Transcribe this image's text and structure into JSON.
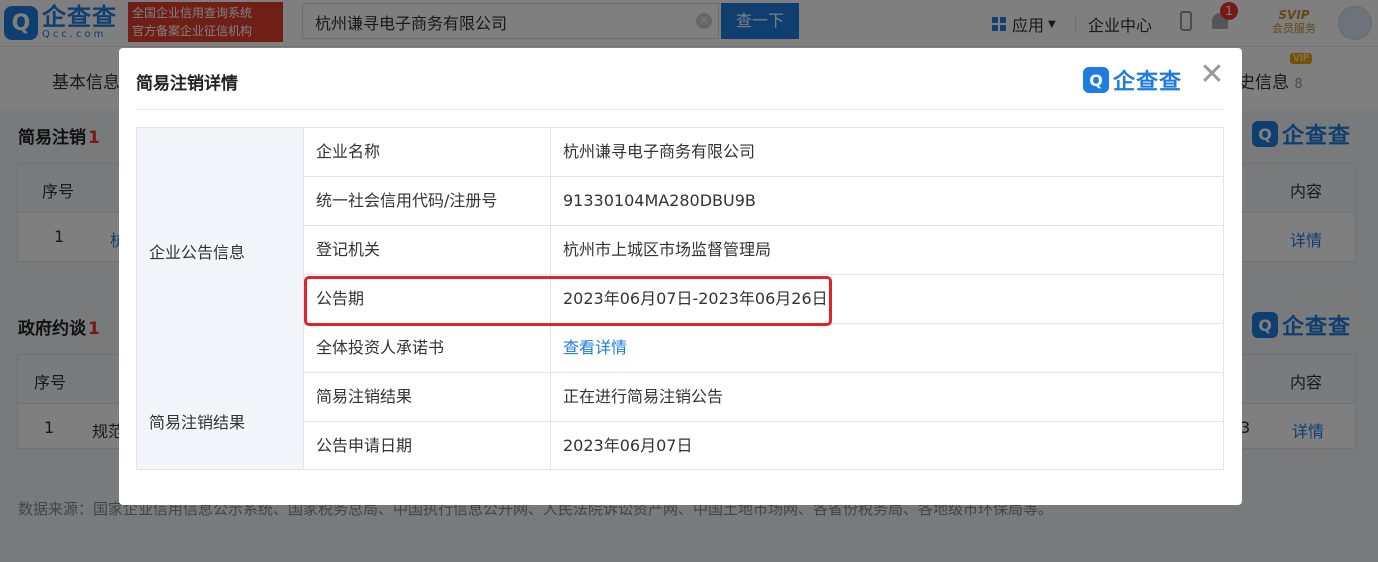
{
  "header": {
    "logo_cn": "企查查",
    "logo_en": "Qcc.com",
    "slogan_line1": "全国企业信用查询系统",
    "slogan_line2": "官方备案企业征信机构",
    "search_value": "杭州谦寻电子商务有限公司",
    "search_button": "查一下",
    "nav_app": "应用",
    "nav_center": "企业中心",
    "notification_count": "1",
    "svip_label": "SVIP",
    "svip_sub": "会员服务"
  },
  "subnav": {
    "basic_info": "基本信息",
    "history_info": "史信息",
    "history_count": "8",
    "vip_badge": "VIP"
  },
  "background": {
    "section1_title": "简易注销",
    "section1_count": "1",
    "section2_title": "政府约谈",
    "section2_count": "1",
    "col_index": "序号",
    "col_content": "内容",
    "row_index": "1",
    "row1_partial": "杭",
    "row2_partial": "规范",
    "row2_tail": "3",
    "detail_link": "详情",
    "source_text": "数据来源：国家企业信用信息公示系统、国家税务总局、中国执行信息公开网、人民法院诉讼资产网、中国土地市场网、各省份税务局、各地级市环保局等。",
    "logo_cn": "企查查"
  },
  "modal": {
    "title": "简易注销详情",
    "logo_cn": "企查查",
    "groups": [
      {
        "name": "企业公告信息",
        "rows": [
          {
            "label": "企业名称",
            "value": "杭州谦寻电子商务有限公司"
          },
          {
            "label": "统一社会信用代码/注册号",
            "value": "91330104MA280DBU9B"
          },
          {
            "label": "登记机关",
            "value": "杭州市上城区市场监督管理局"
          },
          {
            "label": "公告期",
            "value": "2023年06月07日-2023年06月26日"
          },
          {
            "label": "全体投资人承诺书",
            "value": "查看详情"
          }
        ]
      },
      {
        "name": "简易注销结果",
        "rows": [
          {
            "label": "简易注销结果",
            "value": "正在进行简易注销公告"
          },
          {
            "label": "公告申请日期",
            "value": "2023年06月07日"
          }
        ]
      }
    ]
  },
  "colors": {
    "brand_blue": "#1e7ce0",
    "highlight_red": "#e0252a"
  }
}
